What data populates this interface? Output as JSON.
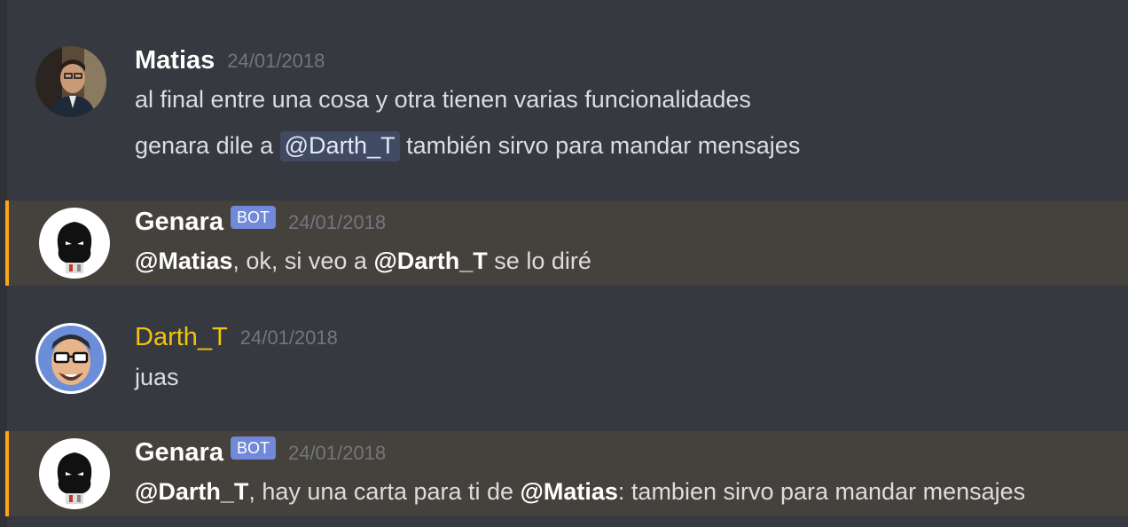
{
  "messages": [
    {
      "username": "Matias",
      "timestamp": "24/01/2018",
      "lines": [
        "al final entre una cosa y otra tienen varias funcionalidades",
        {
          "before": "genara dile a",
          "mention": "@Darth_T",
          "after": "también sirvo para mandar mensajes"
        }
      ]
    },
    {
      "username": "Genara",
      "bot_tag": "BOT",
      "timestamp": "24/01/2018",
      "mention1": "@Matias",
      "text1": ", ok, si veo a ",
      "mention2": "@Darth_T",
      "text2": " se lo diré"
    },
    {
      "username": "Darth_T",
      "timestamp": "24/01/2018",
      "text": "juas"
    },
    {
      "username": "Genara",
      "bot_tag": "BOT",
      "timestamp": "24/01/2018",
      "mention1": "@Darth_T",
      "text1": ", hay una carta para ti de ",
      "mention2": "@Matias",
      "text2": ": tambien sirvo para mandar mensajes"
    }
  ],
  "colors": {
    "background": "#36393f",
    "highlight_bg": "#45423d",
    "highlight_bar": "#faa61a",
    "bot_tag": "#7289da",
    "darth_name": "#f1c40f",
    "timestamp": "#72767d",
    "mention_pill": "#414a63"
  }
}
